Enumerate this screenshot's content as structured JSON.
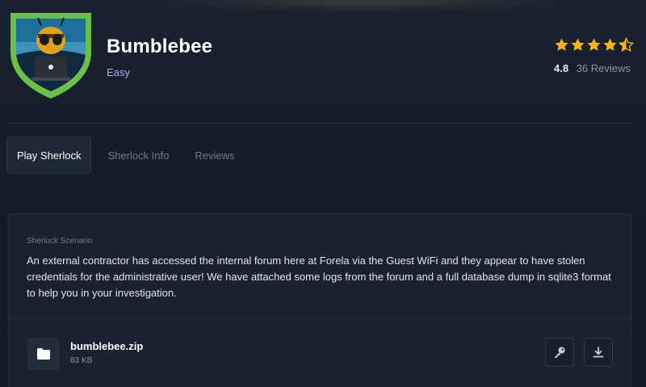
{
  "challenge": {
    "title": "Bumblebee",
    "difficulty": "Easy",
    "badge_icon": "bee-hacker-shield-icon",
    "accent_color": "#6cc04a"
  },
  "rating": {
    "value": "4.8",
    "score": 4.8,
    "max": 5,
    "reviews_label": "36 Reviews",
    "star_color": "#f6b21b"
  },
  "tabs": [
    {
      "label": "Play Sherlock",
      "active": true
    },
    {
      "label": "Sherlock Info",
      "active": false
    },
    {
      "label": "Reviews",
      "active": false
    }
  ],
  "scenario": {
    "label": "Sherlock Scenario",
    "text": "An external contractor has accessed the internal forum here at Forela via the Guest WiFi and they appear to have stolen credentials for the administrative user! We have attached some logs from the forum and a full database dump in sqlite3 format to help you in your investigation."
  },
  "file": {
    "name": "bumblebee.zip",
    "size": "83 KB",
    "icon": "folder-icon",
    "actions": [
      "key-icon",
      "download-icon"
    ]
  }
}
